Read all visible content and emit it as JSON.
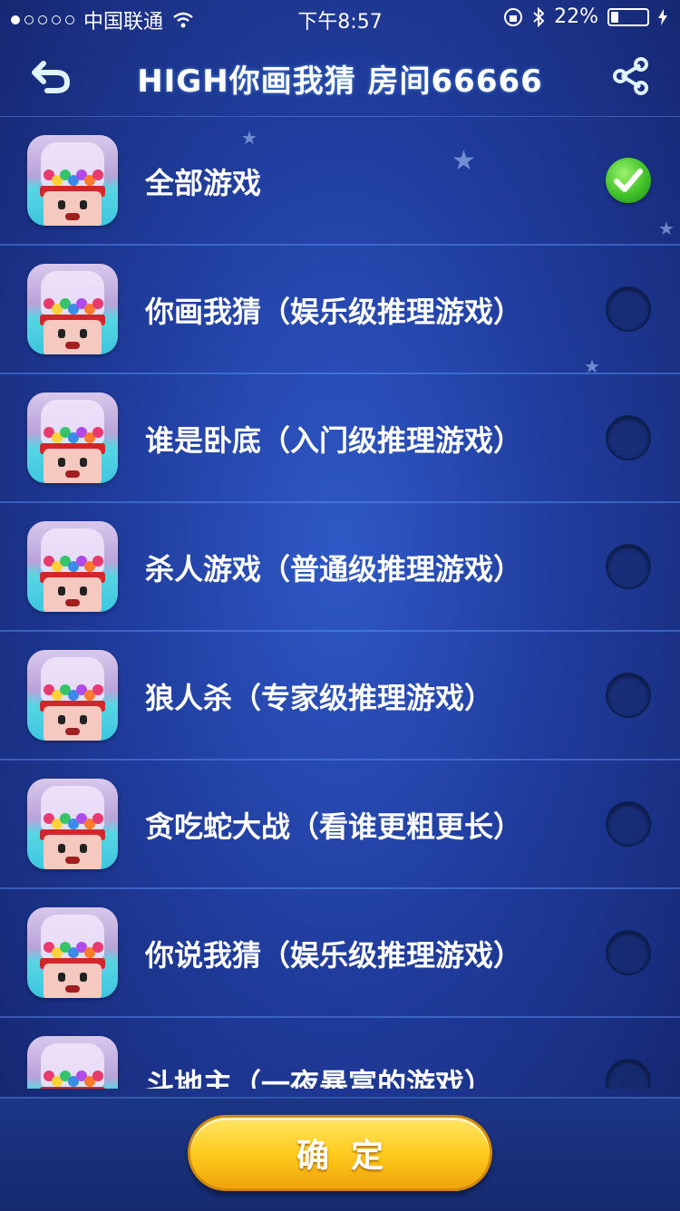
{
  "status_bar": {
    "carrier": "中国联通",
    "time": "下午8:57",
    "battery": "22%"
  },
  "header": {
    "title": "HIGH你画我猜 房间66666"
  },
  "games": [
    {
      "label": "全部游戏",
      "selected": true
    },
    {
      "label": "你画我猜（娱乐级推理游戏）",
      "selected": false
    },
    {
      "label": "谁是卧底（入门级推理游戏）",
      "selected": false
    },
    {
      "label": "杀人游戏（普通级推理游戏）",
      "selected": false
    },
    {
      "label": "狼人杀（专家级推理游戏）",
      "selected": false
    },
    {
      "label": "贪吃蛇大战（看谁更粗更长）",
      "selected": false
    },
    {
      "label": "你说我猜（娱乐级推理游戏）",
      "selected": false
    },
    {
      "label": "斗地主（一夜暴富的游戏）",
      "selected": false
    }
  ],
  "confirm_label": "确定",
  "colors": {
    "background": "#203d9e",
    "accent": "#ffcc1e",
    "check": "#41c12a"
  }
}
